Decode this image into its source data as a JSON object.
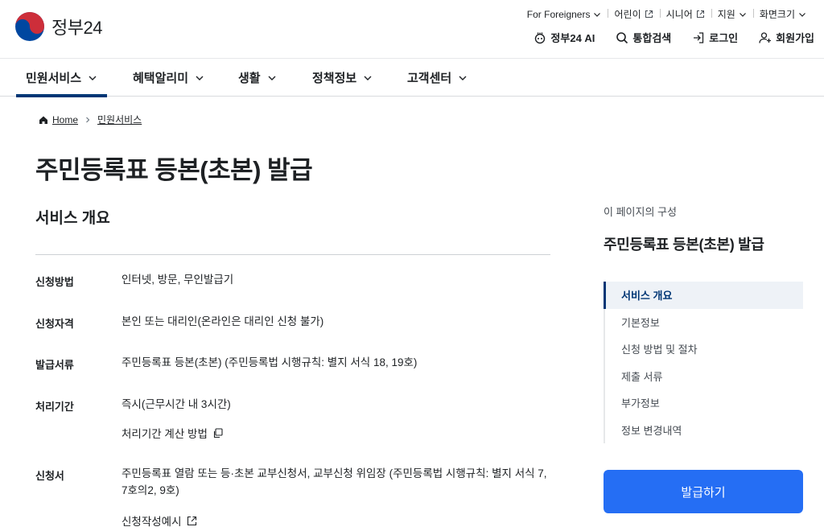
{
  "header": {
    "logo_text": "정부24",
    "utility": {
      "foreigners": "For Foreigners",
      "kids": "어린이",
      "senior": "시니어",
      "support": "지원",
      "font_size": "화면크기"
    },
    "actions": {
      "ai": "정부24 AI",
      "search": "통합검색",
      "login": "로그인",
      "signup": "회원가입"
    }
  },
  "gnb": {
    "items": [
      {
        "label": "민원서비스",
        "active": true
      },
      {
        "label": "혜택알리미",
        "active": false
      },
      {
        "label": "생활",
        "active": false
      },
      {
        "label": "정책정보",
        "active": false
      },
      {
        "label": "고객센터",
        "active": false
      }
    ]
  },
  "breadcrumb": {
    "home": "Home",
    "current": "민원서비스"
  },
  "page": {
    "title": "주민등록표 등본(초본) 발급"
  },
  "overview": {
    "title": "서비스 개요",
    "rows": [
      {
        "label": "신청방법",
        "value": "인터넷, 방문, 무인발급기"
      },
      {
        "label": "신청자격",
        "value": "본인 또는 대리인(온라인은 대리인 신청 불가)"
      },
      {
        "label": "발급서류",
        "value": "주민등록표 등본(초본) (주민등록법 시행규칙: 별지 서식 18, 19호)"
      },
      {
        "label": "처리기간",
        "value": "즉시(근무시간 내 3시간)",
        "link": "처리기간 계산 방법"
      },
      {
        "label": "신청서",
        "value_line1": "주민등록표 열람 또는 등·초본 교부신청서, 교부신청 위임장 (주민등록법 시행규칙: 별지 서식 7,",
        "value_line2": "7호의2, 9호)",
        "link": "신청작성예시"
      }
    ]
  },
  "toc": {
    "caption": "이 페이지의 구성",
    "title": "주민등록표 등본(초본) 발급",
    "items": [
      {
        "label": "서비스 개요",
        "active": true
      },
      {
        "label": "기본정보",
        "active": false
      },
      {
        "label": "신청 방법 및 절차",
        "active": false
      },
      {
        "label": "제출 서류",
        "active": false
      },
      {
        "label": "부가정보",
        "active": false
      },
      {
        "label": "정보 변경내역",
        "active": false
      }
    ]
  },
  "apply_button": "발급하기",
  "colors": {
    "primary_navy": "#003675",
    "button_blue": "#256ef4",
    "logo_red": "#cd2e3a",
    "logo_blue": "#0047a0"
  }
}
